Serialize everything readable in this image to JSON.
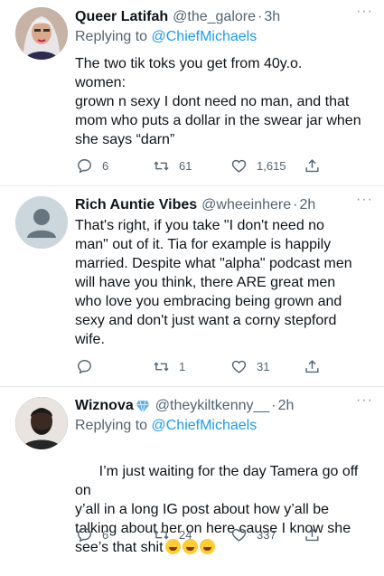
{
  "tweets": [
    {
      "name": "Queer Latifah",
      "handle": "@the_galore",
      "dot": "·",
      "time": "3h",
      "more": "···",
      "replying_prefix": "Replying to",
      "replying_to": "@ChiefMichaels",
      "text": "The two tik toks you get from 40y.o.\nwomen:\ngrown n sexy I dont need no man, and that\nmom who puts a dollar in the swear jar when\nshe says “darn”",
      "replies": "6",
      "retweets": "61",
      "likes": "1,615",
      "avatar_icon": "profile-photo"
    },
    {
      "name": "Rich Auntie Vibes",
      "handle": "@wheeinhere",
      "dot": "·",
      "time": "2h",
      "more": "···",
      "text": "That's right, if you take \"I don't need no\nman\" out of it. Tia for example is happily\nmarried. Despite what \"alpha\" podcast men\nwill have you think, there ARE great men\nwho love you embracing being grown and\nsexy and don't just want a corny stepford\nwife.",
      "replies": "",
      "retweets": "1",
      "likes": "31",
      "avatar_icon": "default-profile-icon"
    },
    {
      "name": "Wiznova",
      "handle": "@theykiltkenny__",
      "dot": "·",
      "time": "2h",
      "more": "···",
      "replying_prefix": "Replying to",
      "replying_to": "@ChiefMichaels",
      "text": "I’m just waiting for the day Tamera go off on\ny’all in a long IG post about how y’all be\ntalking about her on here cause I know she\nsee’s that shit",
      "emoji_count": 3,
      "replies": "6",
      "retweets": "24",
      "likes": "337",
      "avatar_icon": "profile-photo",
      "badge_icon": "blue-diamond-emoji"
    }
  ],
  "colors": {
    "text": "#0f1419",
    "secondary": "#536471",
    "link": "#1d9bf0",
    "divider": "#e6e9ec"
  }
}
